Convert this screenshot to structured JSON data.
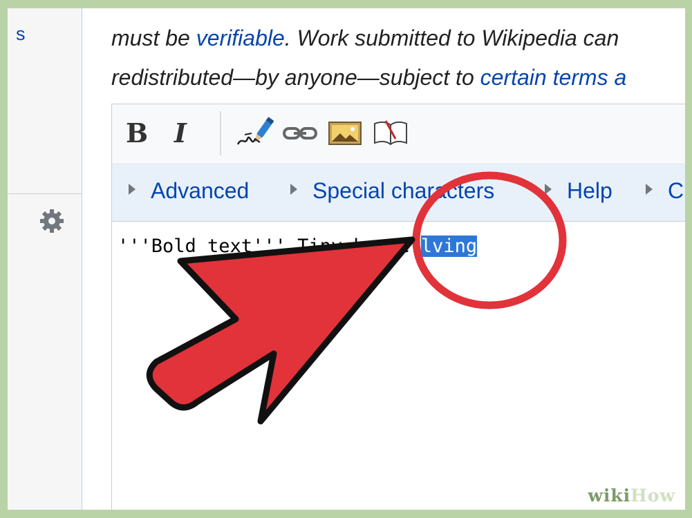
{
  "sidebar": {
    "link_fragment": "s",
    "settings_icon": "gear-icon"
  },
  "article": {
    "line1_before": "must be ",
    "line1_link": "verifiable",
    "line1_after": ". Work submitted to Wikipedia can",
    "line2_before": "redistributed—by anyone—subject to ",
    "line2_link": "certain terms a"
  },
  "toolbar": {
    "bold_label": "B",
    "italic_label": "I",
    "icons": [
      "signature-icon",
      "link-icon",
      "image-icon",
      "reference-icon"
    ]
  },
  "tabs": [
    {
      "label": "Advanced"
    },
    {
      "label": "Special characters"
    },
    {
      "label": "Help"
    },
    {
      "label": "C"
    }
  ],
  "editor": {
    "text_before": "'''Bold text''' Tiny house ",
    "selected_text": "lving"
  },
  "colors": {
    "link": "#0645ad",
    "selection": "#2f77d6",
    "annotation_red": "#e2323a",
    "frame_green": "#b9d3a6"
  },
  "watermark": {
    "wiki": "wiki",
    "how": "How"
  }
}
